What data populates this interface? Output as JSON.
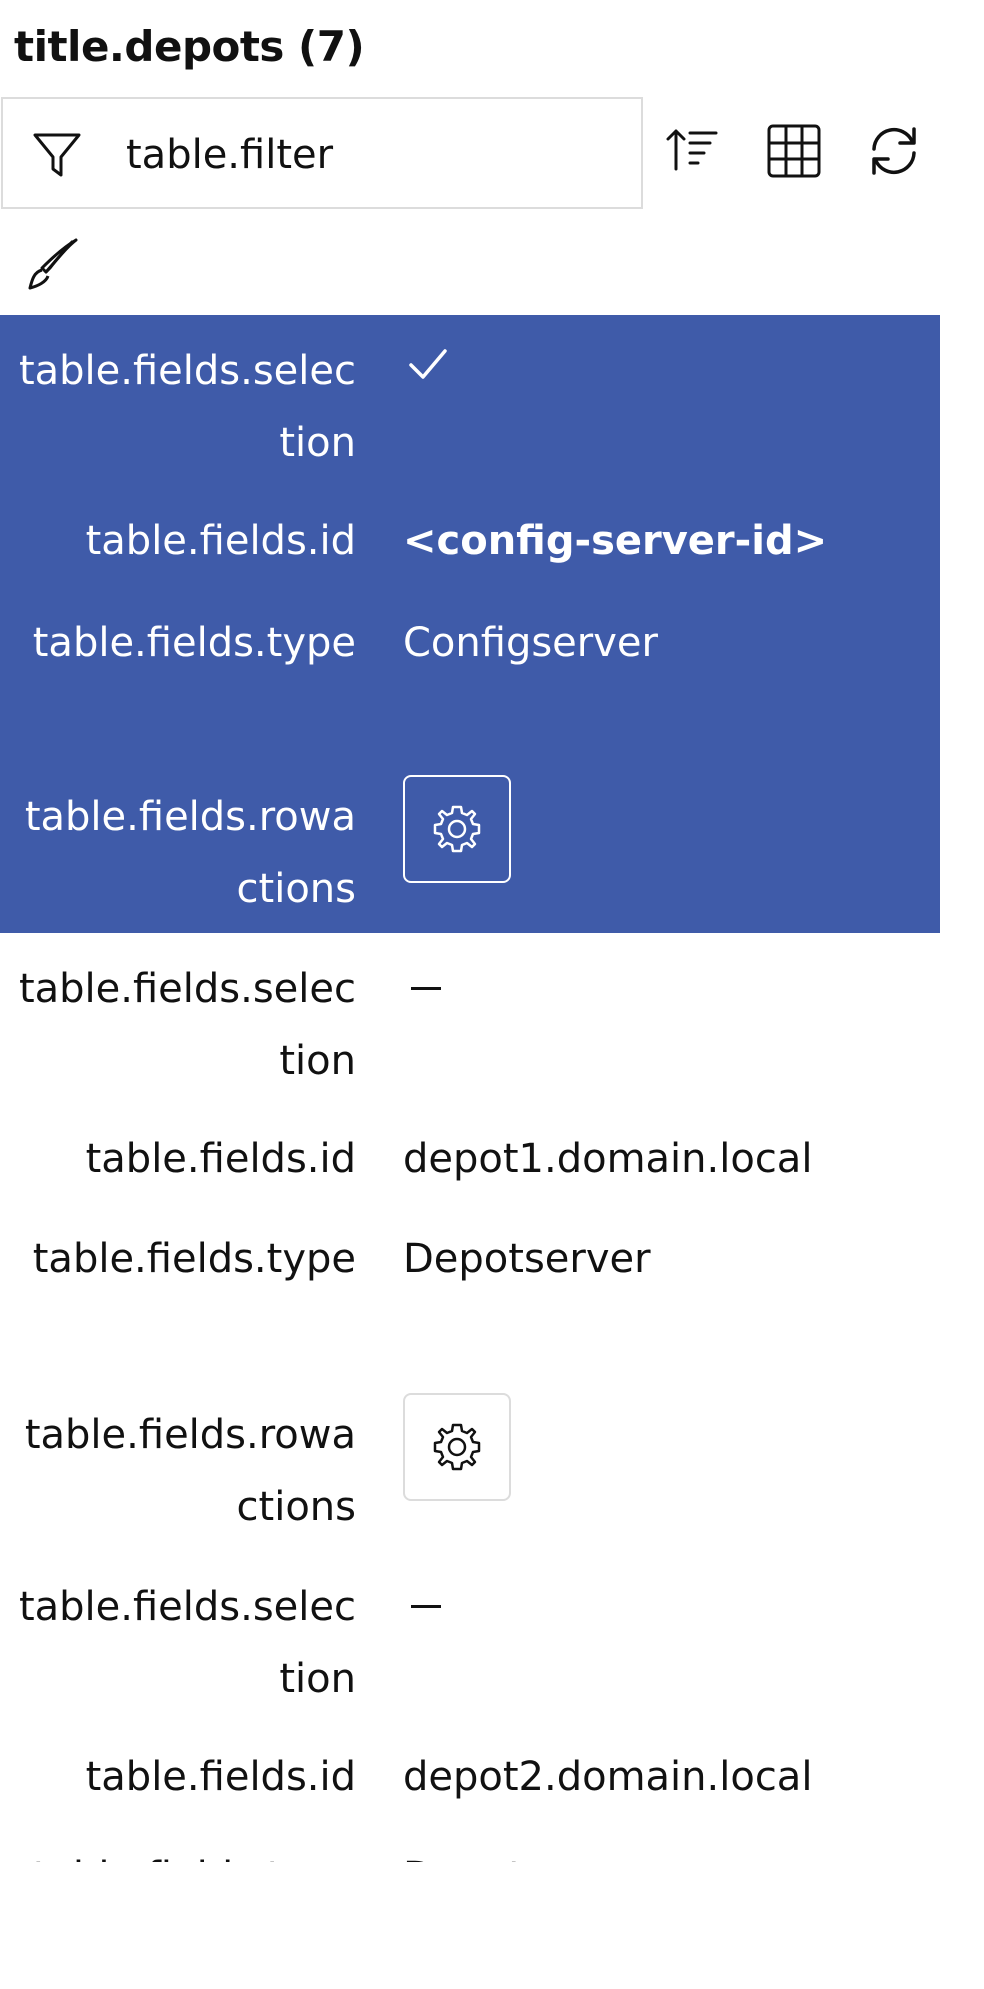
{
  "header": {
    "title": "title.depots (7)"
  },
  "toolbar": {
    "filter_placeholder": "table.filter",
    "icons": [
      "filter-icon",
      "sort-icon",
      "grid-icon",
      "refresh-icon",
      "paintbrush-icon"
    ]
  },
  "fields": {
    "selection": "table.fields.selection",
    "id": "table.fields.id",
    "type": "table.fields.type",
    "rowactions": "table.fields.rowactions"
  },
  "rows": [
    {
      "selected": true,
      "selection": "checked",
      "id": "<config-server-id>",
      "type": "Configserver"
    },
    {
      "selected": false,
      "selection": "unchecked",
      "id": "depot1.domain.local",
      "type": "Depotserver"
    },
    {
      "selected": false,
      "selection": "unchecked",
      "id": "depot2.domain.local",
      "type": "Depotserver"
    }
  ],
  "colors": {
    "selected_row": "#3f5ba9",
    "selected_text": "#ffffff",
    "border": "#dcdcdc"
  }
}
